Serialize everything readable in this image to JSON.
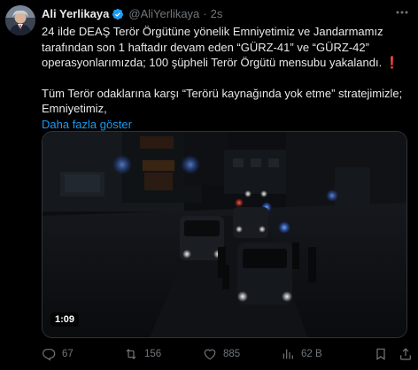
{
  "author": {
    "name": "Ali Yerlikaya",
    "handle": "@AliYerlikaya",
    "separator": "·",
    "time": "2s",
    "verified_color": "#1d9bf0"
  },
  "post": {
    "line1": "24 ilde DEAŞ Terör Örgütüne yönelik Emniyetimiz ve Jandarmamız tarafından son 1 haftadır devam eden “GÜRZ-41” ve “GÜRZ-42” operasyonlarımızda; 100 şüpheli Terör Örgütü mensubu yakalandı.",
    "exclamation": "❗️",
    "line2": "Tüm Terör odaklarına karşı “Terörü kaynağında yok etme” stratejimizle; Emniyetimiz,",
    "show_more": "Daha fazla göster"
  },
  "media": {
    "type": "video",
    "duration": "1:09"
  },
  "actions": {
    "replies": "67",
    "reposts": "156",
    "likes": "885",
    "views": "62 B"
  },
  "icons": {
    "more": "more-icon",
    "reply": "reply-icon",
    "repost": "repost-icon",
    "like": "heart-icon",
    "views": "views-icon",
    "bookmark": "bookmark-icon",
    "share": "share-icon"
  },
  "colors": {
    "background": "#000000",
    "text": "#e7e9ea",
    "secondary": "#71767b",
    "link": "#1d9bf0",
    "alert": "#f4212e"
  }
}
